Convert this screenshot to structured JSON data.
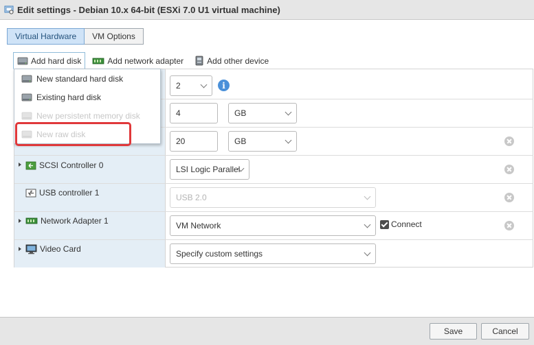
{
  "window": {
    "title": "Edit settings - Debian 10.x 64-bit (ESXi 7.0 U1 virtual machine)"
  },
  "tabs": [
    {
      "label": "Virtual Hardware",
      "active": true
    },
    {
      "label": "VM Options",
      "active": false
    }
  ],
  "add_bar": {
    "hard_disk": "Add hard disk",
    "network_adapter": "Add network adapter",
    "other_device": "Add other device"
  },
  "add_disk_menu": {
    "items": [
      {
        "label": "New standard hard disk",
        "enabled": true
      },
      {
        "label": "Existing hard disk",
        "enabled": true
      },
      {
        "label": "New persistent memory disk",
        "enabled": false
      },
      {
        "label": "New raw disk",
        "enabled": false
      }
    ],
    "highlighted_item": "New raw disk"
  },
  "hardware": {
    "cpu": {
      "value": "2"
    },
    "memory": {
      "value": "4",
      "unit": "GB"
    },
    "hard_disk_1": {
      "value": "20",
      "unit": "GB"
    },
    "scsi": {
      "label": "SCSI Controller 0",
      "value": "LSI Logic Parallel"
    },
    "usb": {
      "label": "USB controller 1",
      "value": "USB 2.0"
    },
    "network": {
      "label": "Network Adapter 1",
      "value": "VM Network",
      "connect_label": "Connect",
      "connected": true
    },
    "video": {
      "label": "Video Card",
      "value": "Specify custom settings"
    }
  },
  "footer": {
    "save": "Save",
    "cancel": "Cancel"
  },
  "colors": {
    "label_column_bg": "#e4eef6",
    "active_tab_bg": "#cfe3f7",
    "highlight_border": "#e0383a",
    "info_icon": "#4a90d9"
  }
}
